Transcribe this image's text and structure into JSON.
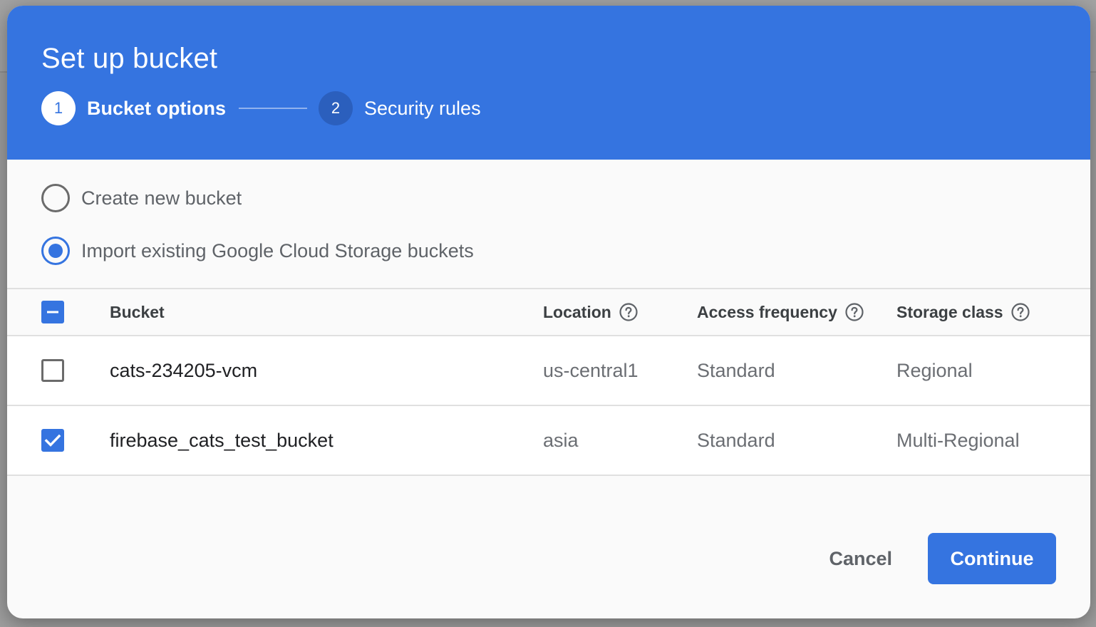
{
  "dialog": {
    "title": "Set up bucket",
    "steps": [
      {
        "number": "1",
        "label": "Bucket options",
        "state": "active"
      },
      {
        "number": "2",
        "label": "Security rules",
        "state": "inactive"
      }
    ]
  },
  "options": {
    "create_new": {
      "label": "Create new bucket",
      "selected": false
    },
    "import_existing": {
      "label": "Import existing Google Cloud Storage buckets",
      "selected": true
    }
  },
  "table": {
    "select_all_state": "indeterminate",
    "headers": {
      "bucket": "Bucket",
      "location": "Location",
      "access": "Access frequency",
      "storage": "Storage class"
    },
    "rows": [
      {
        "checked": false,
        "bucket": "cats-234205-vcm",
        "location": "us-central1",
        "access": "Standard",
        "storage": "Regional"
      },
      {
        "checked": true,
        "bucket": "firebase_cats_test_bucket",
        "location": "asia",
        "access": "Standard",
        "storage": "Multi-Regional"
      }
    ]
  },
  "actions": {
    "cancel_label": "Cancel",
    "continue_label": "Continue"
  },
  "icons": {
    "help": "help-circle-icon",
    "check": "check-icon",
    "indeterminate": "minus-icon"
  },
  "colors": {
    "primary": "#3574e0",
    "primary_dark": "#2b5fbd",
    "text_muted": "#5f6368"
  }
}
